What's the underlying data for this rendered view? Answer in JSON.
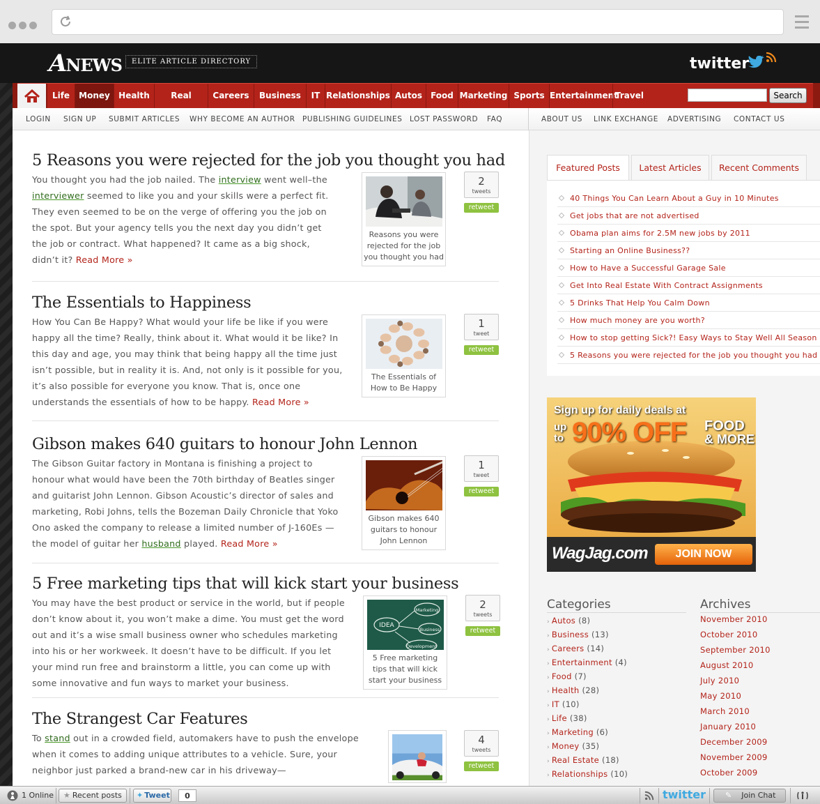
{
  "site": {
    "logo_big": "A",
    "logo_rest": "NEWS",
    "tagline": "ELITE ARTICLE DIRECTORY",
    "twitter_label": "twitter"
  },
  "nav": {
    "items": [
      "Life",
      "Money",
      "Health",
      "Real Estate",
      "Careers",
      "Business",
      "IT",
      "Relationships",
      "Autos",
      "Food",
      "Marketing",
      "Sports",
      "Entertainment",
      "Travel"
    ],
    "active": "Money",
    "search_button": "Search"
  },
  "subnav": {
    "left": [
      "Login",
      "Sign up",
      "Submit Articles",
      "Why Become an Author",
      "Publishing Guidelines",
      "Lost Password",
      "FAQ"
    ],
    "right": [
      "About Us",
      "Link Exchange",
      "Advertising",
      "Contact Us"
    ]
  },
  "posts": [
    {
      "title": "5 Reasons you were rejected for the job you thought you had",
      "body_parts": [
        {
          "t": "You thought you had the job nailed. The "
        },
        {
          "t": "interview",
          "link": true
        },
        {
          "t": " went well–the "
        },
        {
          "t": "interviewer",
          "link": true
        },
        {
          "t": " seemed to like you and your skills were a perfect fit. They even seemed to be on the verge of offering you the job on the spot. But your agency tells you the next day you didn’t get the job or contract. What happened? It came as a big shock, didn’t it? "
        }
      ],
      "read_more": "Read More »",
      "thumb_caption": "Reasons you were rejected for the job you thought you had",
      "tweets": "2",
      "tweets_label": "tweets",
      "retweet": "retweet"
    },
    {
      "title": "The Essentials to Happiness",
      "body_parts": [
        {
          "t": "How You Can Be Happy? What would your life be like if you were happy all the time? Really, think about it. What would it be like? In this day and age, you may think that being happy all the time just isn’t possible, but in reality it is. And, not only is it possible for you, it’s also possible for everyone you know. That is, once one understands the essentials of how to be happy. "
        }
      ],
      "read_more": "Read More »",
      "thumb_caption": "The Essentials of How to Be Happy",
      "tweets": "1",
      "tweets_label": "tweet",
      "retweet": "retweet"
    },
    {
      "title": "Gibson makes 640 guitars to honour John Lennon",
      "body_parts": [
        {
          "t": "The Gibson Guitar factory in Montana is finishing a project to honour what would have been the 70th birthday of Beatles singer and guitarist John Lennon. Gibson Acoustic’s director of sales and marketing, Robi Johns, tells the Bozeman Daily Chronicle that Yoko Ono asked the company to release a limited number of J-160Es — the model of guitar her "
        },
        {
          "t": "husband",
          "link": true
        },
        {
          "t": " played. "
        }
      ],
      "read_more": "Read More »",
      "thumb_caption": "Gibson makes 640 guitars to honour John Lennon",
      "tweets": "1",
      "tweets_label": "tweet",
      "retweet": "retweet"
    },
    {
      "title": "5 Free marketing tips that will kick start your business",
      "body_parts": [
        {
          "t": "You may have the best product or service in the world, but if people don’t know about it, you won’t make a dime. You must get the word out and it’s a wise small business owner who schedules marketing into his or her workweek. It doesn’t have to be difficult. If you let your mind run free and brainstorm a little, you can come up with some innovative and fun ways to market your business."
        }
      ],
      "read_more": "",
      "thumb_caption": "5 Free marketing tips that will kick start your business",
      "thumb_words": [
        "IDEA",
        "Marketing",
        "Business",
        "Development"
      ],
      "tweets": "2",
      "tweets_label": "tweets",
      "retweet": "retweet"
    },
    {
      "title": "The Strangest Car Features",
      "body_parts": [
        {
          "t": "To "
        },
        {
          "t": "stand",
          "link": true
        },
        {
          "t": " out in a crowded field, automakers have to push the envelope when it comes to adding unique attributes to a vehicle. Sure, your neighbor just parked a brand-new car in his driveway—"
        }
      ],
      "read_more": "",
      "thumb_caption": "",
      "tweets": "4",
      "tweets_label": "tweets",
      "retweet": "retweet"
    }
  ],
  "tabs": [
    "Featured Posts",
    "Latest Articles",
    "Recent Comments"
  ],
  "featured": [
    "40 Things You Can Learn About a Guy in 10 Minutes",
    "Get jobs that are not advertised",
    "Obama plan aims for 2.5M new jobs by 2011",
    "Starting an Online Business??",
    "How to Have a Successful Garage Sale",
    "Get Into Real Estate With Contract Assignments",
    "5 Drinks That Help You Calm Down",
    "How much money are you worth?",
    "How to stop getting Sick?! Easy Ways to Stay Well All Season",
    "5 Reasons you were rejected for the job you thought you had"
  ],
  "ad": {
    "line1": "Sign up for daily deals at",
    "up": "up",
    "to": "to",
    "percent": "90% OFF",
    "food": "FOOD",
    "more": "& MORE",
    "brand": "WagJag.com",
    "cta": "JOIN NOW"
  },
  "categories_title": "Categories",
  "categories": [
    {
      "name": "Autos",
      "count": "(8)"
    },
    {
      "name": "Business",
      "count": "(13)"
    },
    {
      "name": "Careers",
      "count": "(14)"
    },
    {
      "name": "Entertainment",
      "count": "(4)"
    },
    {
      "name": "Food",
      "count": "(7)"
    },
    {
      "name": "Health",
      "count": "(28)"
    },
    {
      "name": "IT",
      "count": "(10)"
    },
    {
      "name": "Life",
      "count": "(38)"
    },
    {
      "name": "Marketing",
      "count": "(6)"
    },
    {
      "name": "Money",
      "count": "(35)"
    },
    {
      "name": "Real Estate",
      "count": "(18)"
    },
    {
      "name": "Relationships",
      "count": "(10)"
    }
  ],
  "archives_title": "Archives",
  "archives": [
    "November 2010",
    "October 2010",
    "September 2010",
    "August 2010",
    "July 2010",
    "May 2010",
    "March 2010",
    "January 2010",
    "December 2009",
    "November 2009",
    "October 2009"
  ],
  "bottombar": {
    "online": "1 Online",
    "recent": "Recent posts",
    "tweet": "Tweet",
    "tweet_count": "0",
    "twitter": "twitter",
    "join_chat": "Join Chat"
  },
  "colors": {
    "accent_red": "#b3231a",
    "header_black": "#161616",
    "retweet_green": "#8ec240",
    "link_green": "#2f6b1c"
  }
}
